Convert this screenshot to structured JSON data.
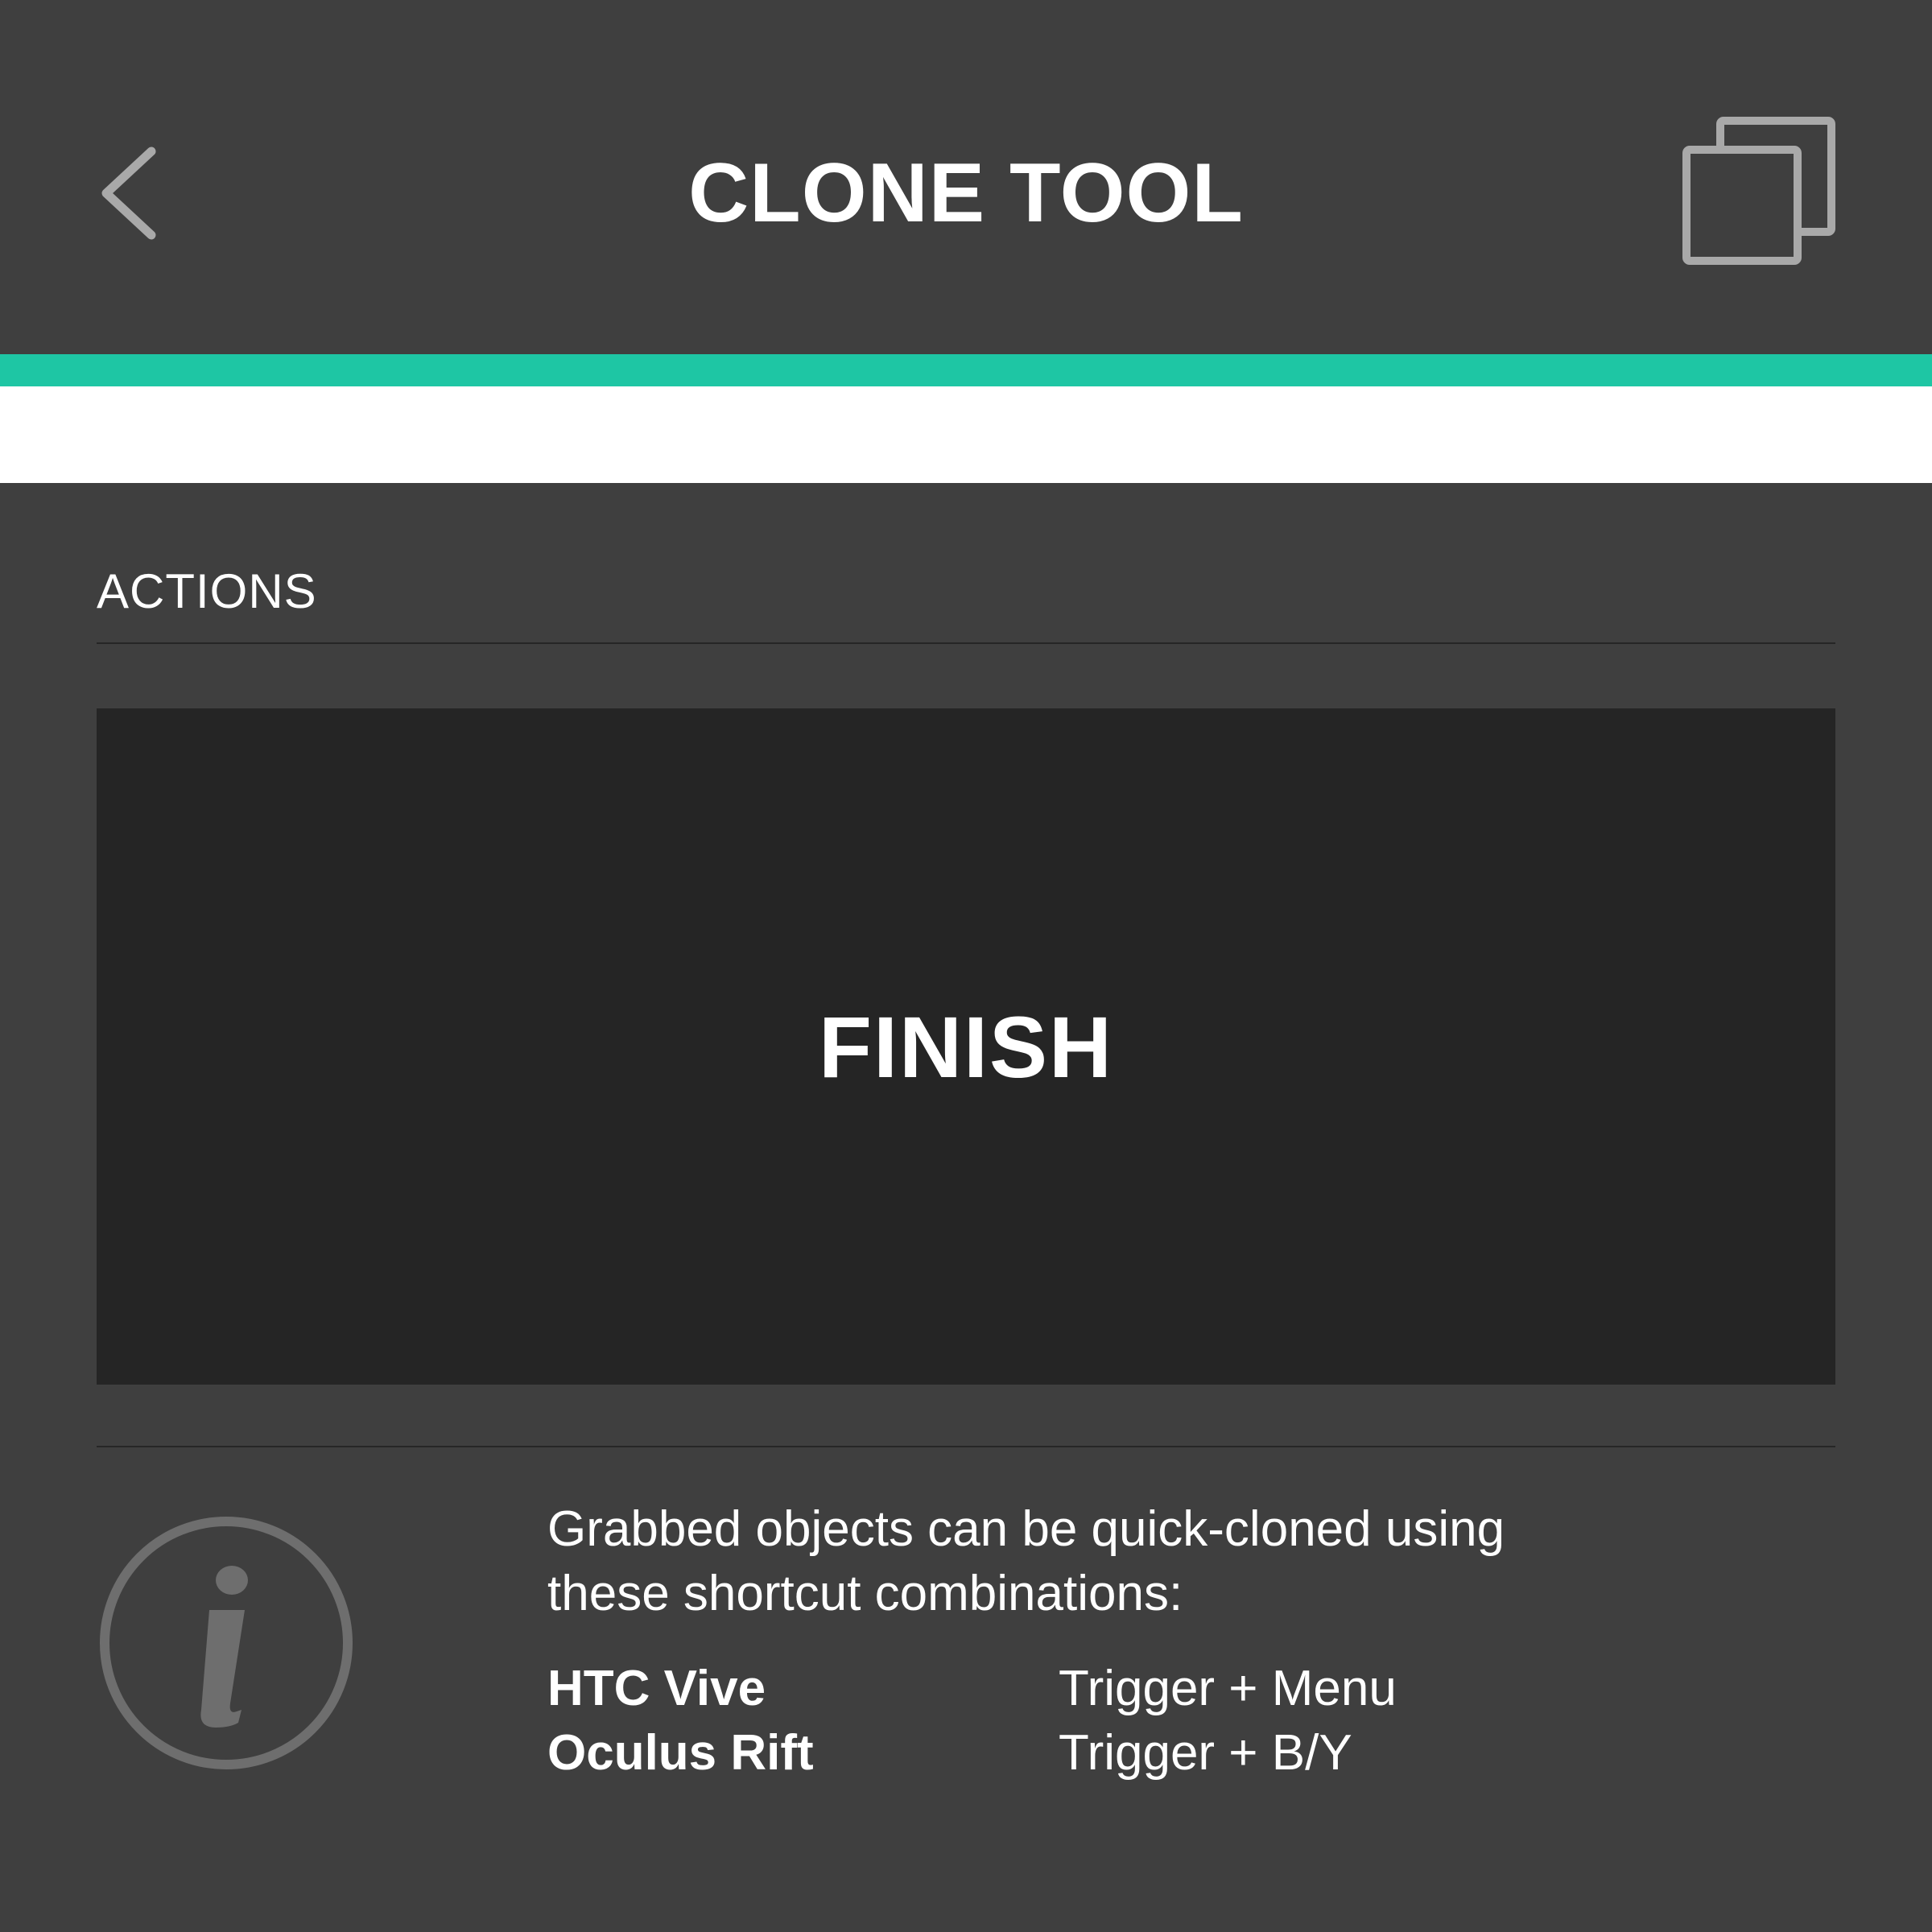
{
  "header": {
    "title": "CLONE TOOL",
    "back_icon": "chevron-left-icon",
    "tool_icon": "clone-icon"
  },
  "colors": {
    "header_bg": "#3f3f3f",
    "accent": "#1ec6a4",
    "panel_bg": "#3f3f3f",
    "button_bg": "#252525",
    "icon_gray": "#a9a9a9",
    "info_icon_gray": "#6e6e6e"
  },
  "actions": {
    "section_label": "ACTIONS",
    "finish_label": "FINISH"
  },
  "info": {
    "icon": "info-icon",
    "description_line1": "Grabbed objects can be quick-cloned using",
    "description_line2": "these shortcut combinations:",
    "shortcuts": [
      {
        "device": "HTC Vive",
        "combo": "Trigger + Menu"
      },
      {
        "device": "Oculus Rift",
        "combo": "Trigger + B/Y"
      }
    ]
  }
}
